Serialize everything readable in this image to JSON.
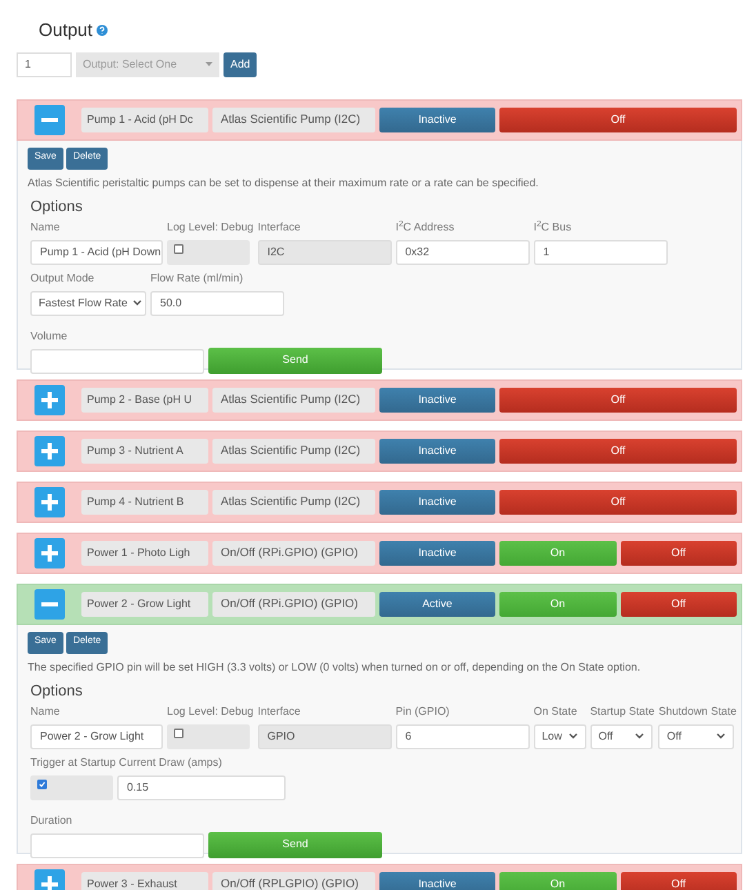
{
  "header": {
    "title": "Output"
  },
  "add_bar": {
    "number": "1",
    "select": "Output: Select One",
    "button": "Add"
  },
  "outputs": [
    {
      "name": "Pump 1 - Acid (pH Dc",
      "type": "Atlas Scientific Pump (I2C)",
      "status": "Inactive",
      "active": false,
      "expanded": true,
      "controls": [
        {
          "kind": "off",
          "label": "Off"
        }
      ],
      "details": {
        "buttons": [
          "Save",
          "Delete"
        ],
        "description": "Atlas Scientific peristaltic pumps can be set to dispense at their maximum rate or a rate can be specified.",
        "options_title": "Options",
        "rows": [
          {
            "items": [
              {
                "kind": "text",
                "label": "Name",
                "value": "Pump 1 - Acid (pH Down"
              },
              {
                "kind": "checkbox",
                "label": "Log Level: Debug",
                "checked": false
              },
              {
                "kind": "readonly",
                "label": "Interface",
                "value": "I2C"
              },
              {
                "kind": "text",
                "label": "I$^{2}$C Address",
                "value": "0x32"
              },
              {
                "kind": "text",
                "label": "I$^{2}$C Bus",
                "value": "1"
              }
            ]
          },
          {
            "items": [
              {
                "kind": "select",
                "label": "Output Mode",
                "value": "Fastest Flow Rate"
              },
              {
                "kind": "text",
                "label": "Flow Rate (ml/min)",
                "value": "50.0"
              }
            ]
          },
          {
            "items": [
              {
                "kind": "text",
                "label": "Volume"
              },
              {
                "kind": "send",
                "label": "Send"
              }
            ]
          }
        ]
      }
    },
    {
      "name": "Pump 2 - Base (pH U",
      "type": "Atlas Scientific Pump (I2C)",
      "status": "Inactive",
      "active": false,
      "expanded": false,
      "controls": [
        {
          "kind": "off",
          "label": "Off"
        }
      ]
    },
    {
      "name": "Pump 3 - Nutrient A",
      "type": "Atlas Scientific Pump (I2C)",
      "status": "Inactive",
      "active": false,
      "expanded": false,
      "controls": [
        {
          "kind": "off",
          "label": "Off"
        }
      ]
    },
    {
      "name": "Pump 4 - Nutrient B",
      "type": "Atlas Scientific Pump (I2C)",
      "status": "Inactive",
      "active": false,
      "expanded": false,
      "controls": [
        {
          "kind": "off",
          "label": "Off"
        }
      ]
    },
    {
      "name": "Power 1 - Photo Ligh",
      "type": "On/Off (RPi.GPIO) (GPIO)",
      "status": "Inactive",
      "active": false,
      "expanded": false,
      "controls": [
        {
          "kind": "on",
          "label": "On"
        },
        {
          "kind": "off",
          "label": "Off"
        }
      ]
    },
    {
      "name": "Power 2 - Grow Light",
      "type": "On/Off (RPi.GPIO) (GPIO)",
      "status": "Active",
      "active": true,
      "expanded": true,
      "controls": [
        {
          "kind": "on",
          "label": "On"
        },
        {
          "kind": "off",
          "label": "Off"
        }
      ],
      "details": {
        "buttons": [
          "Save",
          "Delete"
        ],
        "description": "The specified GPIO pin will be set HIGH (3.3 volts) or LOW (0 volts) when turned on or off, depending on the On State option.",
        "options_title": "Options",
        "rows": [
          {
            "items": [
              {
                "kind": "text",
                "label": "Name",
                "value": "Power 2 - Grow Light"
              },
              {
                "kind": "checkbox",
                "label": "Log Level: Debug",
                "checked": false
              },
              {
                "kind": "readonly",
                "label": "Interface",
                "value": "GPIO"
              },
              {
                "kind": "text",
                "label": "Pin (GPIO)",
                "value": "6"
              },
              {
                "kind": "select",
                "label": "On State",
                "value": "Low"
              },
              {
                "kind": "select",
                "label": "Startup State",
                "value": "Off"
              },
              {
                "kind": "select",
                "label": "Shutdown State",
                "value": "Off"
              }
            ]
          },
          {
            "label": "Trigger at Startup Current Draw (amps)",
            "items": [
              {
                "kind": "checkbox",
                "checked": true
              },
              {
                "kind": "text",
                "value": "0.15"
              }
            ]
          },
          {
            "items": [
              {
                "kind": "text",
                "label": "Duration"
              },
              {
                "kind": "send",
                "label": "Send"
              }
            ]
          }
        ]
      }
    },
    {
      "name": "Power 3 - Exhaust",
      "type": "On/Off (RPLGPIO) (GPIO)",
      "status": "Inactive",
      "active": false,
      "expanded": false,
      "controls": [
        {
          "kind": "on",
          "label": "On"
        },
        {
          "kind": "off",
          "label": "Off"
        }
      ]
    }
  ]
}
